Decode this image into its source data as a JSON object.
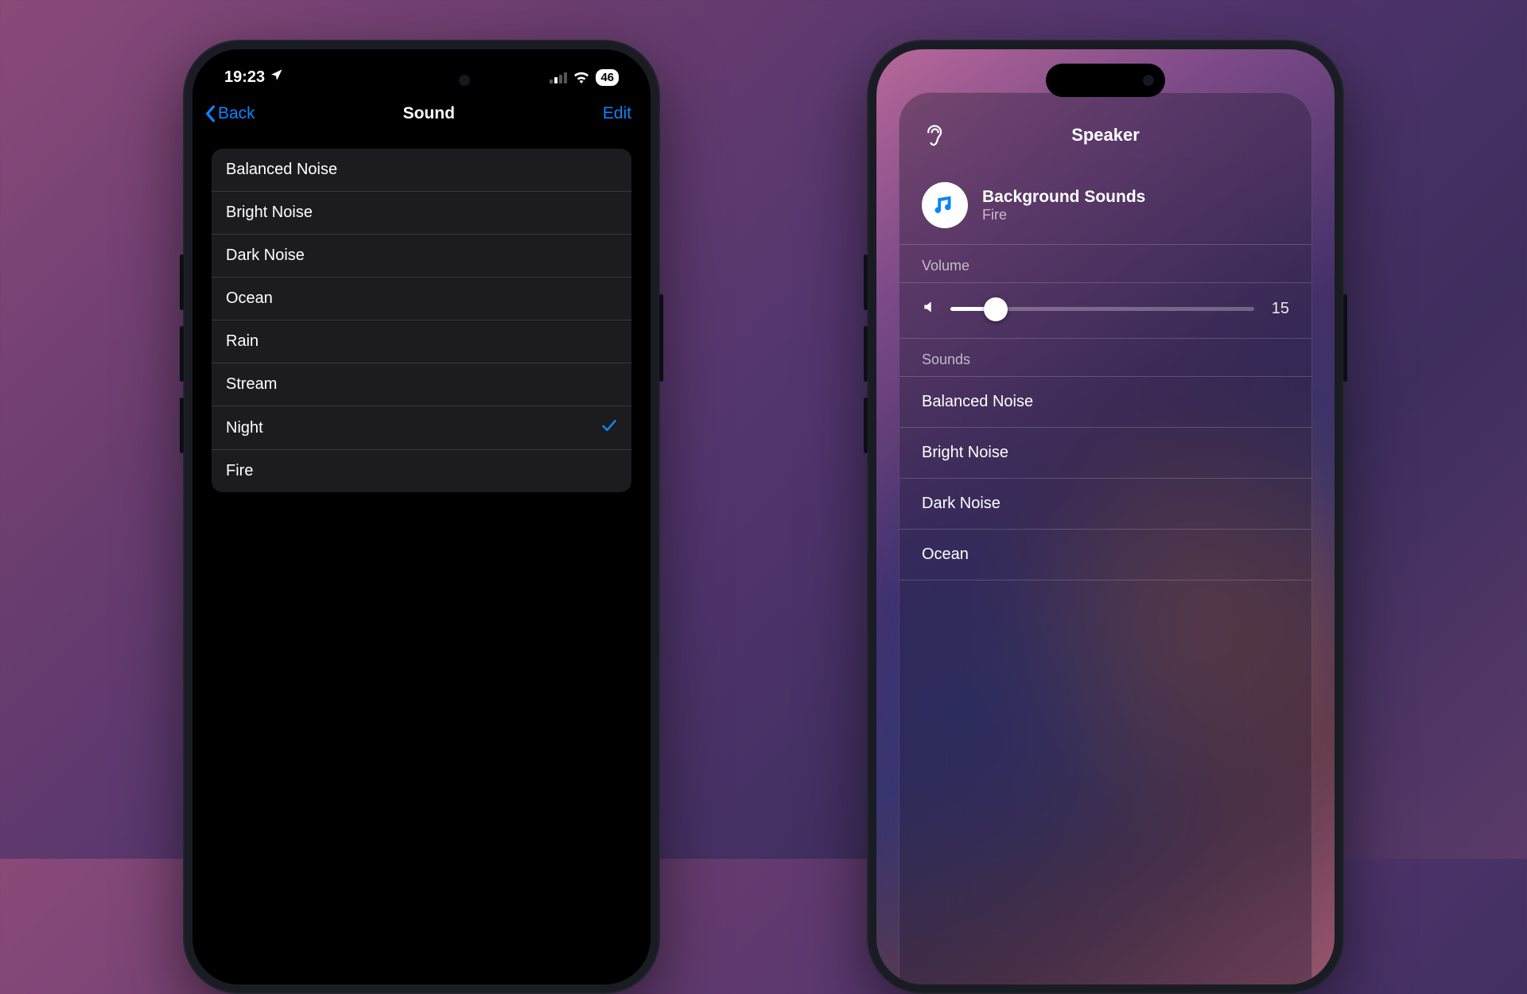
{
  "phone_left": {
    "status": {
      "time": "19:23",
      "battery": "46"
    },
    "nav": {
      "back": "Back",
      "title": "Sound",
      "edit": "Edit"
    },
    "sounds": [
      {
        "label": "Balanced Noise",
        "selected": false
      },
      {
        "label": "Bright Noise",
        "selected": false
      },
      {
        "label": "Dark Noise",
        "selected": false
      },
      {
        "label": "Ocean",
        "selected": false
      },
      {
        "label": "Rain",
        "selected": false
      },
      {
        "label": "Stream",
        "selected": false
      },
      {
        "label": "Night",
        "selected": true
      },
      {
        "label": "Fire",
        "selected": false
      }
    ]
  },
  "phone_right": {
    "panel": {
      "title": "Speaker",
      "now_playing": {
        "title": "Background Sounds",
        "subtitle": "Fire"
      },
      "volume": {
        "label": "Volume",
        "value": "15",
        "percent": 15
      },
      "sounds_label": "Sounds",
      "sounds": [
        {
          "label": "Balanced Noise"
        },
        {
          "label": "Bright Noise"
        },
        {
          "label": "Dark Noise"
        },
        {
          "label": "Ocean"
        }
      ]
    }
  }
}
